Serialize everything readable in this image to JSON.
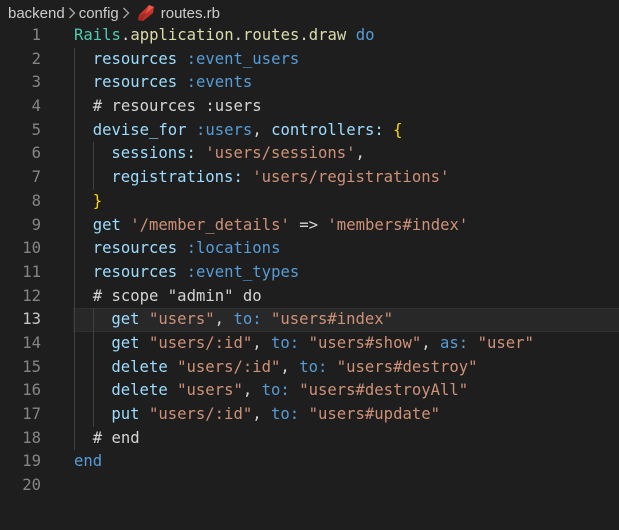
{
  "breadcrumb": {
    "segments": [
      "backend",
      "config",
      "routes.rb"
    ],
    "file_icon": "ruby-gem-icon"
  },
  "colors": {
    "background": "#1e1e1e",
    "line_number": "#858585",
    "ruby_red": "#cc342d"
  },
  "editor": {
    "current_line": 13,
    "lines": [
      {
        "number": "1",
        "indent": 0,
        "tokens": [
          [
            "const",
            "Rails"
          ],
          [
            "punct",
            "."
          ],
          [
            "method",
            "application"
          ],
          [
            "punct",
            "."
          ],
          [
            "method",
            "routes"
          ],
          [
            "punct",
            "."
          ],
          [
            "method",
            "draw"
          ],
          [
            "punct",
            " "
          ],
          [
            "keyword",
            "do"
          ]
        ]
      },
      {
        "number": "2",
        "indent": 1,
        "tokens": [
          [
            "ident",
            "resources"
          ],
          [
            "punct",
            " "
          ],
          [
            "symbol",
            ":event_users"
          ]
        ]
      },
      {
        "number": "3",
        "indent": 1,
        "tokens": [
          [
            "ident",
            "resources"
          ],
          [
            "punct",
            " "
          ],
          [
            "symbol",
            ":events"
          ]
        ]
      },
      {
        "number": "4",
        "indent": 1,
        "tokens": [
          [
            "comment",
            "# resources :users"
          ]
        ]
      },
      {
        "number": "5",
        "indent": 1,
        "tokens": [
          [
            "ident",
            "devise_for"
          ],
          [
            "punct",
            " "
          ],
          [
            "symbol",
            ":users"
          ],
          [
            "punct",
            ", "
          ],
          [
            "ident",
            "controllers:"
          ],
          [
            "punct",
            " "
          ],
          [
            "brace",
            "{"
          ]
        ]
      },
      {
        "number": "6",
        "indent": 2,
        "tokens": [
          [
            "ident",
            "sessions:"
          ],
          [
            "punct",
            " "
          ],
          [
            "string",
            "'users/sessions'"
          ],
          [
            "punct",
            ","
          ]
        ]
      },
      {
        "number": "7",
        "indent": 2,
        "tokens": [
          [
            "ident",
            "registrations:"
          ],
          [
            "punct",
            " "
          ],
          [
            "string",
            "'users/registrations'"
          ]
        ]
      },
      {
        "number": "8",
        "indent": 1,
        "tokens": [
          [
            "brace",
            "}"
          ]
        ]
      },
      {
        "number": "9",
        "indent": 1,
        "tokens": [
          [
            "ident",
            "get"
          ],
          [
            "punct",
            " "
          ],
          [
            "string",
            "'/member_details'"
          ],
          [
            "punct",
            " "
          ],
          [
            "operator",
            "=>"
          ],
          [
            "punct",
            " "
          ],
          [
            "string",
            "'members#index'"
          ]
        ]
      },
      {
        "number": "10",
        "indent": 1,
        "tokens": [
          [
            "ident",
            "resources"
          ],
          [
            "punct",
            " "
          ],
          [
            "symbol",
            ":locations"
          ]
        ]
      },
      {
        "number": "11",
        "indent": 1,
        "tokens": [
          [
            "ident",
            "resources"
          ],
          [
            "punct",
            " "
          ],
          [
            "symbol",
            ":event_types"
          ]
        ]
      },
      {
        "number": "12",
        "indent": 1,
        "tokens": [
          [
            "comment",
            "# scope \"admin\" do"
          ]
        ]
      },
      {
        "number": "13",
        "indent": 2,
        "tokens": [
          [
            "ident",
            "get"
          ],
          [
            "punct",
            " "
          ],
          [
            "string",
            "\"users\""
          ],
          [
            "punct",
            ", "
          ],
          [
            "symbol",
            "to:"
          ],
          [
            "punct",
            " "
          ],
          [
            "string",
            "\"users#index\""
          ]
        ]
      },
      {
        "number": "14",
        "indent": 2,
        "tokens": [
          [
            "ident",
            "get"
          ],
          [
            "punct",
            " "
          ],
          [
            "string",
            "\"users/:id\""
          ],
          [
            "punct",
            ", "
          ],
          [
            "symbol",
            "to:"
          ],
          [
            "punct",
            " "
          ],
          [
            "string",
            "\"users#show\""
          ],
          [
            "punct",
            ", "
          ],
          [
            "symbol",
            "as:"
          ],
          [
            "punct",
            " "
          ],
          [
            "string",
            "\"user\""
          ]
        ]
      },
      {
        "number": "15",
        "indent": 2,
        "tokens": [
          [
            "ident",
            "delete"
          ],
          [
            "punct",
            " "
          ],
          [
            "string",
            "\"users/:id\""
          ],
          [
            "punct",
            ", "
          ],
          [
            "symbol",
            "to:"
          ],
          [
            "punct",
            " "
          ],
          [
            "string",
            "\"users#destroy\""
          ]
        ]
      },
      {
        "number": "16",
        "indent": 2,
        "tokens": [
          [
            "ident",
            "delete"
          ],
          [
            "punct",
            " "
          ],
          [
            "string",
            "\"users\""
          ],
          [
            "punct",
            ", "
          ],
          [
            "symbol",
            "to:"
          ],
          [
            "punct",
            " "
          ],
          [
            "string",
            "\"users#destroyAll\""
          ]
        ]
      },
      {
        "number": "17",
        "indent": 2,
        "tokens": [
          [
            "ident",
            "put"
          ],
          [
            "punct",
            " "
          ],
          [
            "string",
            "\"users/:id\""
          ],
          [
            "punct",
            ", "
          ],
          [
            "symbol",
            "to:"
          ],
          [
            "punct",
            " "
          ],
          [
            "string",
            "\"users#update\""
          ]
        ]
      },
      {
        "number": "18",
        "indent": 1,
        "tokens": [
          [
            "comment",
            "# end"
          ]
        ]
      },
      {
        "number": "19",
        "indent": 0,
        "tokens": [
          [
            "keyword",
            "end"
          ]
        ]
      },
      {
        "number": "20",
        "indent": 0,
        "tokens": []
      }
    ]
  }
}
